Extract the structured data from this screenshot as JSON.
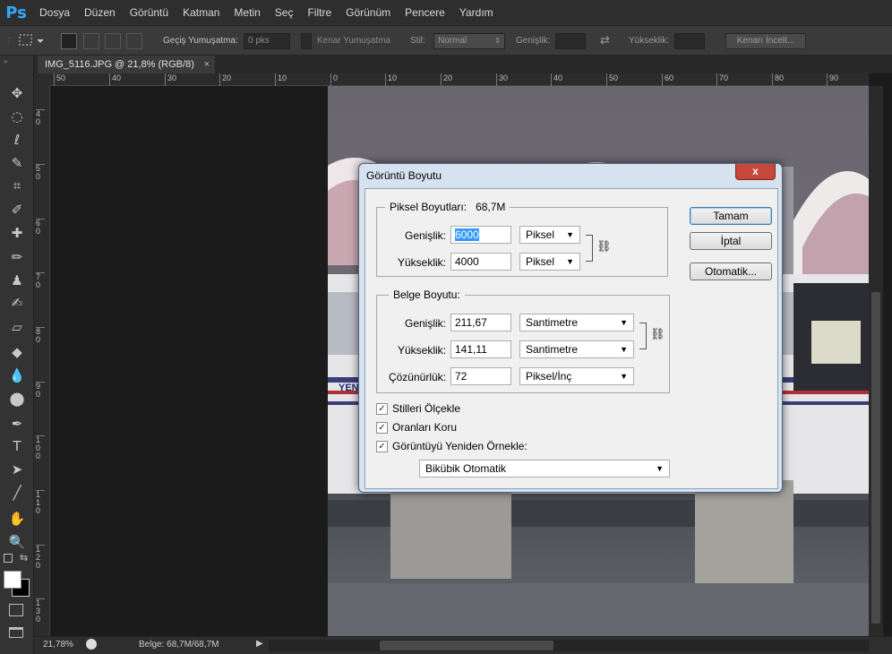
{
  "app": {
    "logo": "Ps",
    "menu": [
      "Dosya",
      "Düzen",
      "Görüntü",
      "Katman",
      "Metin",
      "Seç",
      "Filtre",
      "Görünüm",
      "Pencere",
      "Yardım"
    ]
  },
  "options_bar": {
    "feather_label": "Geçiş Yumuşatma:",
    "feather_value": "0 pks",
    "anti_alias_label": "Kenar Yumuşatma",
    "style_label": "Stil:",
    "style_value": "Normal",
    "width_label": "Genişlik:",
    "height_label": "Yükseklik:",
    "refine_edge_label": "Kenarı İncelt..."
  },
  "tools": [
    "move-tool",
    "marquee-tool",
    "lasso-tool",
    "quick-selection-tool",
    "crop-tool",
    "eyedropper-tool",
    "spot-healing-tool",
    "brush-tool",
    "clone-stamp-tool",
    "history-brush-tool",
    "eraser-tool",
    "paint-bucket-tool",
    "blur-tool",
    "dodge-tool",
    "pen-tool",
    "type-tool",
    "path-selection-tool",
    "line-tool",
    "hand-tool",
    "zoom-tool"
  ],
  "tool_glyphs": [
    "✥",
    "◌",
    "ℓ",
    "✎",
    "⌗",
    "✐",
    "✚",
    "✏",
    "♟",
    "✍",
    "▱",
    "◆",
    "💧",
    "⬤",
    "✒",
    "T",
    "➤",
    "╱",
    "✋",
    "🔍"
  ],
  "document": {
    "tab_title": "IMG_5116.JPG @ 21,8% (RGB/8)",
    "close_glyph": "×"
  },
  "ruler_top": [
    "50",
    "40",
    "30",
    "20",
    "10",
    "0",
    "10",
    "20",
    "30",
    "40",
    "50",
    "60",
    "70",
    "80",
    "90"
  ],
  "ruler_left": [
    "4 0",
    "5 0",
    "6 0",
    "7 0",
    "8 0",
    "9 0",
    "1 0 0",
    "1 1 0",
    "1 2 0",
    "1 3 0"
  ],
  "status": {
    "zoom": "21,78%",
    "doc_info": "Belge: 68,7M/68,7M"
  },
  "dialog": {
    "title": "Görüntü Boyutu",
    "close_glyph": "x",
    "pixel_dims_label": "Piksel Boyutları:",
    "pixel_dims_value": "68,7M",
    "px_width_label": "Genişlik:",
    "px_width_value": "6000",
    "px_width_unit": "Piksel",
    "px_height_label": "Yükseklik:",
    "px_height_value": "4000",
    "px_height_unit": "Piksel",
    "doc_size_label": "Belge Boyutu:",
    "doc_width_label": "Genişlik:",
    "doc_width_value": "211,67",
    "doc_width_unit": "Santimetre",
    "doc_height_label": "Yükseklik:",
    "doc_height_value": "141,11",
    "doc_height_unit": "Santimetre",
    "resolution_label": "Çözünürlük:",
    "resolution_value": "72",
    "resolution_unit": "Piksel/İnç",
    "scale_styles_label": "Stilleri Ölçekle",
    "constrain_label": "Oranları Koru",
    "resample_label": "Görüntüyü Yeniden Örnekle:",
    "resample_method": "Bikübik Otomatik",
    "ok_label": "Tamam",
    "cancel_label": "İptal",
    "auto_label": "Otomatik...",
    "checkbox_glyph": "✓",
    "link_glyph": "⛓",
    "dropdown_glyph": "▼"
  }
}
